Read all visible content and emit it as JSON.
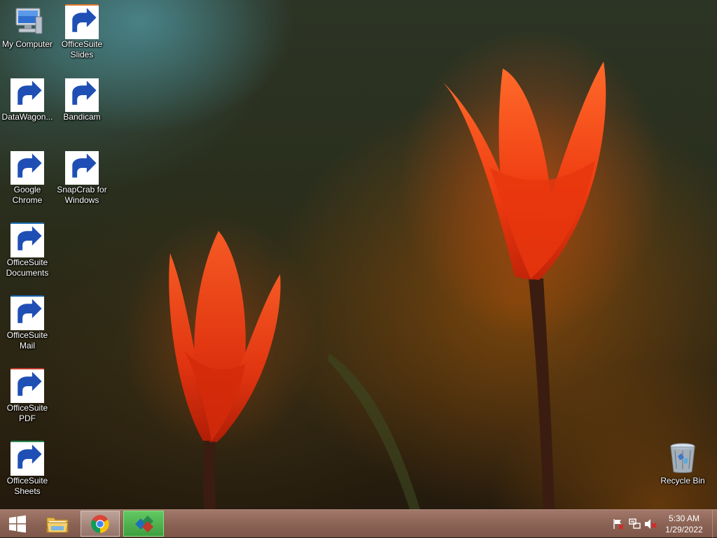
{
  "desktop": {
    "icons": [
      {
        "label": "My Computer",
        "icon": "computer-icon",
        "shortcut": false
      },
      {
        "label": "OfficeSuite\nSlides",
        "icon": "slides-icon",
        "shortcut": true
      },
      {
        "label": "DataWagon...",
        "icon": "datawagon-icon",
        "shortcut": true
      },
      {
        "label": "Bandicam",
        "icon": "bandicam-icon",
        "shortcut": true
      },
      {
        "label": "Google\nChrome",
        "icon": "chrome-icon",
        "shortcut": true
      },
      {
        "label": "SnapCrab for\nWindows",
        "icon": "camera-icon",
        "shortcut": true
      },
      {
        "label": "OfficeSuite\nDocuments",
        "icon": "documents-icon",
        "shortcut": true
      },
      {
        "label": "OfficeSuite\nMail",
        "icon": "mail-icon",
        "shortcut": true
      },
      {
        "label": "OfficeSuite\nPDF",
        "icon": "pdf-icon",
        "shortcut": true
      },
      {
        "label": "OfficeSuite\nSheets",
        "icon": "sheets-icon",
        "shortcut": true
      },
      {
        "label": "Recycle Bin",
        "icon": "recycle-bin-icon",
        "shortcut": false
      }
    ]
  },
  "taskbar": {
    "start": {
      "icon": "windows-logo-icon"
    },
    "pinned": [
      {
        "name": "File Explorer",
        "icon": "folder-icon"
      },
      {
        "name": "Google Chrome",
        "icon": "chrome-icon",
        "active": true
      },
      {
        "name": "OfficeSuite",
        "icon": "officesuite-icon",
        "highlighted": true
      }
    ],
    "tray": {
      "icons": [
        "action-center-flag-icon",
        "network-icon",
        "volume-muted-icon"
      ],
      "time": "5:30 AM",
      "date": "1/29/2022"
    }
  },
  "colors": {
    "taskbar": "#8a6254",
    "tulip": "#f04a14",
    "highlight_green": "#4caf4c"
  }
}
